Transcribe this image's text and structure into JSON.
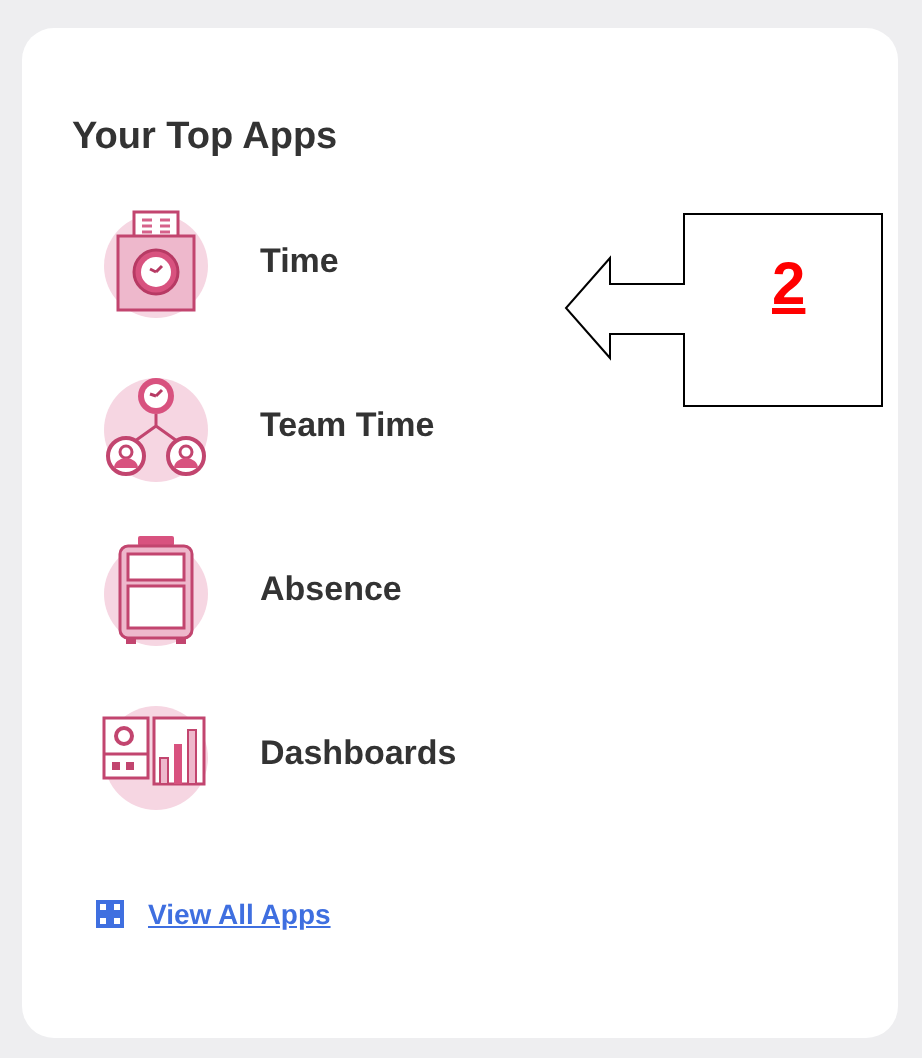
{
  "card": {
    "title": "Your Top Apps"
  },
  "apps": [
    {
      "label": "Time",
      "kind": "timecard"
    },
    {
      "label": "Team Time",
      "kind": "team"
    },
    {
      "label": "Absence",
      "kind": "suitcase"
    },
    {
      "label": "Dashboards",
      "kind": "dashboard"
    }
  ],
  "link": {
    "label": "View All Apps"
  },
  "callout": {
    "label": "2"
  }
}
